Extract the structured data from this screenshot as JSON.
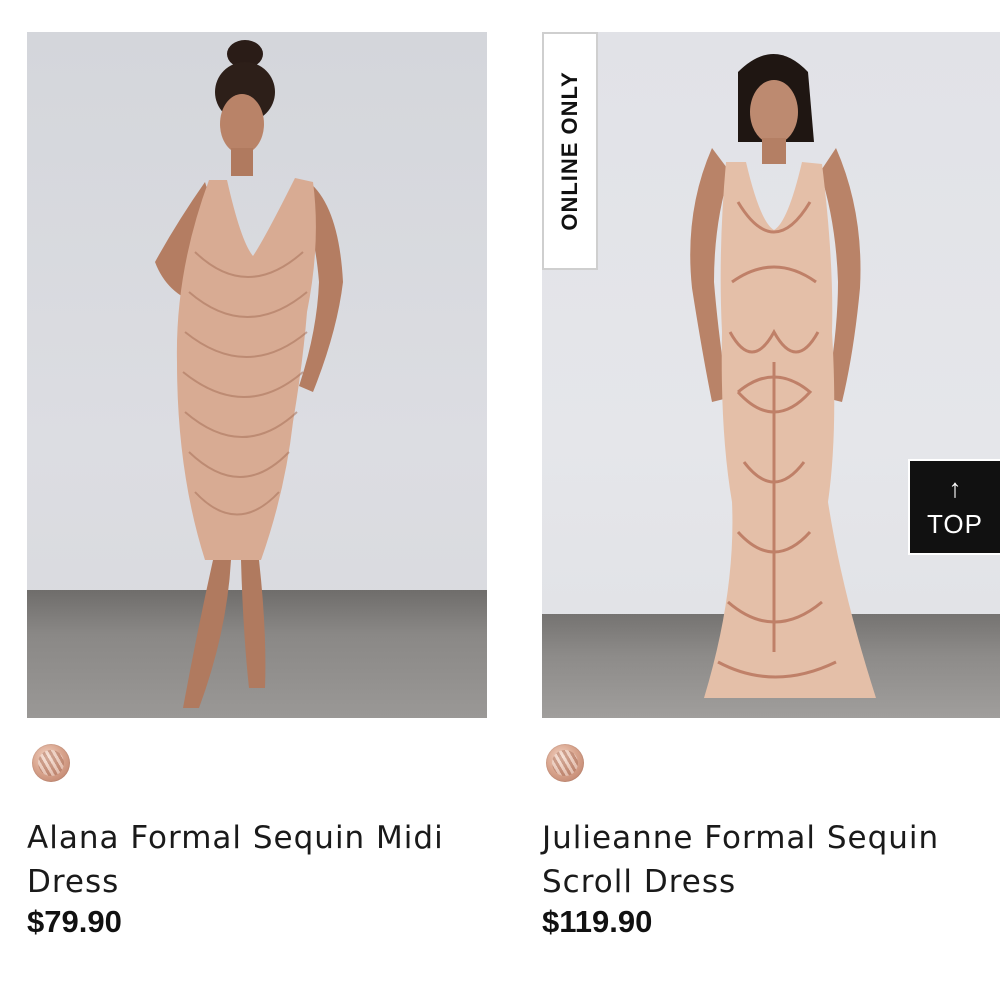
{
  "products": [
    {
      "name": "Alana Formal Sequin Midi Dress",
      "price": "$79.90",
      "badge": "",
      "swatch_color": "#d9a58e"
    },
    {
      "name": "Julieanne Formal Sequin Scroll Dress",
      "price": "$119.90",
      "badge": "ONLINE ONLY",
      "swatch_color": "#d8a08a"
    }
  ],
  "top_button": {
    "arrow": "↑",
    "label": "TOP",
    "icon": "arrow-up-icon"
  }
}
